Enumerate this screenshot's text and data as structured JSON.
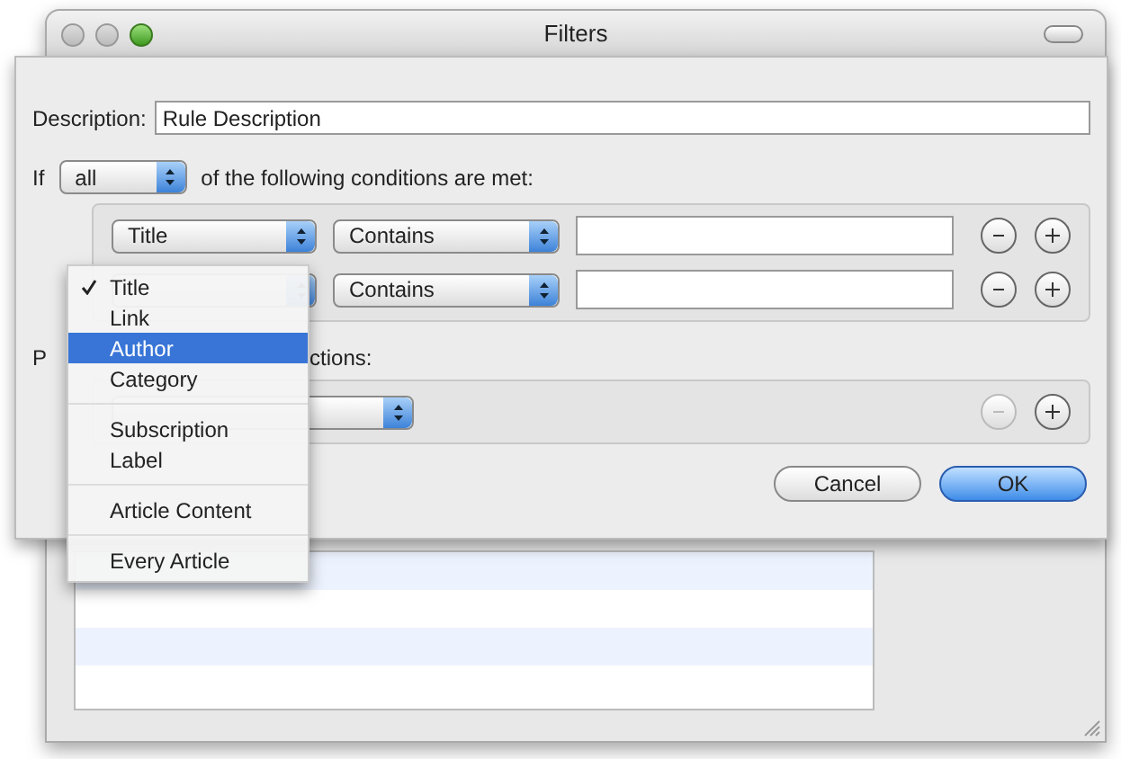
{
  "window": {
    "title": "Filters"
  },
  "description": {
    "label": "Description:",
    "value": "Rule Description"
  },
  "match": {
    "prefix": "If",
    "value": "all",
    "suffix": "of the following conditions are met:"
  },
  "conditions": [
    {
      "field": "Title",
      "operator": "Contains",
      "remove_disabled": false
    },
    {
      "operator": "Contains",
      "remove_disabled": false
    }
  ],
  "actions_label": {
    "visible_start": "P",
    "visible_end": "ctions:"
  },
  "actions": [
    {
      "remove_disabled": true
    }
  ],
  "buttons": [
    {
      "label": "Cancel",
      "default": false
    },
    {
      "label": "OK",
      "default": true
    }
  ],
  "menu": {
    "items": [
      {
        "kind": "item",
        "label": "Title",
        "checked": true,
        "selected": false
      },
      {
        "kind": "item",
        "label": "Link",
        "checked": false,
        "selected": false
      },
      {
        "kind": "item",
        "label": "Author",
        "checked": false,
        "selected": true
      },
      {
        "kind": "item",
        "label": "Category",
        "checked": false,
        "selected": false
      },
      {
        "kind": "separator"
      },
      {
        "kind": "item",
        "label": "Subscription",
        "checked": false,
        "selected": false
      },
      {
        "kind": "item",
        "label": "Label",
        "checked": false,
        "selected": false
      },
      {
        "kind": "separator"
      },
      {
        "kind": "item",
        "label": "Article Content",
        "checked": false,
        "selected": false
      },
      {
        "kind": "separator"
      },
      {
        "kind": "item",
        "label": "Every Article",
        "checked": false,
        "selected": false
      }
    ]
  }
}
